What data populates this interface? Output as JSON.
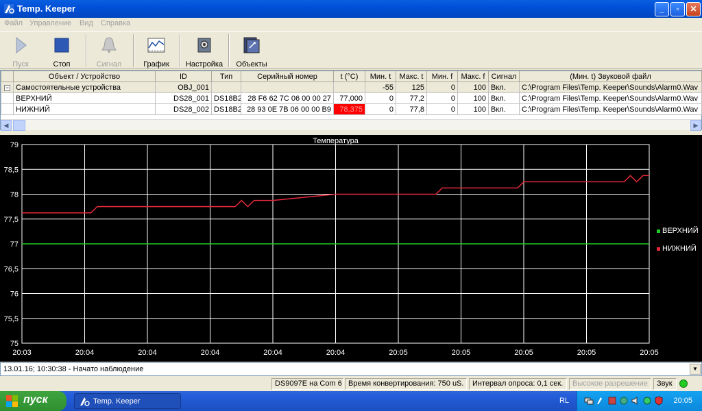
{
  "window": {
    "title": "Temp. Keeper"
  },
  "menu": [
    "Файл",
    "Управление",
    "Вид",
    "Справка"
  ],
  "toolbar": {
    "start": "Пуск",
    "stop": "Стоп",
    "signal": "Сигнал",
    "graph": "График",
    "settings": "Настройка",
    "objects": "Объекты"
  },
  "table": {
    "headers": [
      "Объект / Устройство",
      "ID",
      "Тип",
      "Серийный номер",
      "t (°C)",
      "Мин. t",
      "Макс. t",
      "Мин. f",
      "Макс. f",
      "Сигнал",
      "(Мин. t) Звуковой файл"
    ],
    "group": {
      "expander": "−",
      "name": "Самостоятельные устройства",
      "id": "OBJ_001",
      "min_t": "-55",
      "max_t": "125",
      "min_f": "0",
      "max_f": "100",
      "signal": "Вкл.",
      "file": "C:\\Program Files\\Temp. Keeper\\Sounds\\Alarm0.Wav"
    },
    "rows": [
      {
        "name": "ВЕРХНИЙ",
        "id": "DS28_001",
        "type": "DS18B20",
        "serial": "28 F6 62 7C 06 00 00 27",
        "t": "77,000",
        "min_t": "0",
        "max_t": "77,2",
        "min_f": "0",
        "max_f": "100",
        "signal": "Вкл.",
        "file": "C:\\Program Files\\Temp. Keeper\\Sounds\\Alarm0.Wav"
      },
      {
        "name": "НИЖНИЙ",
        "id": "DS28_002",
        "type": "DS18B20",
        "serial": "28 93 0E 7B 06 00 00 B9",
        "t": "78,375",
        "min_t": "0",
        "max_t": "77,8",
        "min_f": "0",
        "max_f": "100",
        "signal": "Вкл.",
        "file": "C:\\Program Files\\Temp. Keeper\\Sounds\\Alarm0.Wav"
      }
    ]
  },
  "chart_data": {
    "type": "line",
    "title": "Температура",
    "ylim": [
      75,
      79
    ],
    "yticks": [
      "75",
      "75,5",
      "76",
      "76,5",
      "77",
      "77,5",
      "78",
      "78,5",
      "79"
    ],
    "xtick_labels": [
      "20:03",
      "20:04",
      "20:04",
      "20:04",
      "20:04",
      "20:04",
      "20:05",
      "20:05",
      "20:05",
      "20:05",
      "20:05"
    ],
    "grid": true,
    "legend_position": "right",
    "series": [
      {
        "name": "ВЕРХНИЙ",
        "color": "#22cc22",
        "x": [
          0,
          10
        ],
        "values": [
          77.0,
          77.0
        ]
      },
      {
        "name": "НИЖНИЙ",
        "color": "#e8293c",
        "x": [
          0,
          1.1,
          1.2,
          3.4,
          3.5,
          3.6,
          3.7,
          4.0,
          5.0,
          6.6,
          6.7,
          7.9,
          8.0,
          9.6,
          9.7,
          9.8,
          9.9,
          10.0
        ],
        "values": [
          77.625,
          77.625,
          77.75,
          77.75,
          77.875,
          77.75,
          77.875,
          77.875,
          78.0,
          78.0,
          78.125,
          78.125,
          78.25,
          78.25,
          78.375,
          78.25,
          78.375,
          78.375
        ]
      }
    ]
  },
  "log": {
    "text": "13.01.16; 10:30:38 - Начато наблюдение"
  },
  "status": {
    "adapter": "DS9097E на Com 6",
    "conv_time": "Время конвертирования: 750 uS.",
    "interval": "Интервал опроса: 0,1 сек.",
    "resolution": "Высокое разрешение",
    "sound": "Звук"
  },
  "taskbar": {
    "start": "пуск",
    "task": "Temp. Keeper",
    "lang": "RL",
    "clock": "20:05"
  }
}
